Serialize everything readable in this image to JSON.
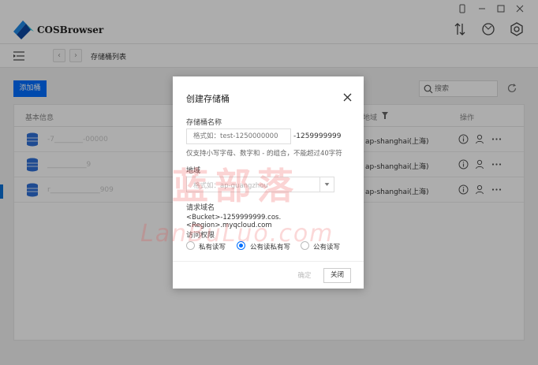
{
  "app": {
    "name": "COSBrowser"
  },
  "breadcrumb": {
    "current": "存储桶列表"
  },
  "toolbar": {
    "add_bucket_label": "添加桶",
    "search_placeholder": "搜索"
  },
  "table": {
    "columns": {
      "info": "基本信息",
      "region": "地域",
      "actions": "操作"
    },
    "rows": [
      {
        "name": "-7________-00000",
        "region": "ap-shanghai(上海)"
      },
      {
        "name": "___________9",
        "region": "ap-shanghai(上海)"
      },
      {
        "name": "r______________909",
        "region": "ap-shanghai(上海)"
      }
    ]
  },
  "dialog": {
    "title": "创建存储桶",
    "bucket_name_label": "存储桶名称",
    "bucket_name_placeholder": "格式如：test-1250000000",
    "bucket_name_suffix": "-1259999999",
    "bucket_name_hint": "仅支持小写字母、数字和 - 的组合，不能超过40字符",
    "region_label": "地域",
    "region_placeholder": "格式如：ap-guangzhou",
    "domain_label": "请求域名",
    "domain_value": "<Bucket>-1259999999.cos.<Region>.myqcloud.com",
    "access_label": "访问权限",
    "access_options": [
      "私有读写",
      "公有读私有写",
      "公有读写"
    ],
    "access_selected": "公有读私有写",
    "confirm_label": "确定",
    "close_label": "关闭"
  },
  "watermark": {
    "cn": "蓝部落",
    "en": "LanBuLuo.com"
  },
  "colors": {
    "primary": "#006eff",
    "watermark": "#ec3c3c"
  },
  "icons": {
    "titlebar": [
      "transfer-icon",
      "sync-icon",
      "settings-icon"
    ],
    "row_actions": [
      "info-icon",
      "user-permission-icon",
      "more-icon"
    ]
  }
}
